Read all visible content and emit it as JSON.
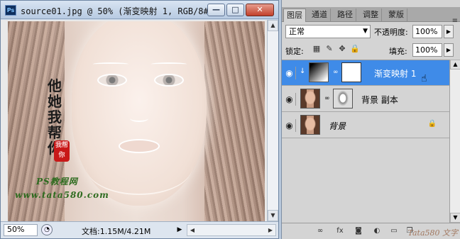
{
  "document": {
    "ps_badge": "Ps",
    "title": "source01.jpg @ 50% (渐变映射 1, RGB/8#) *",
    "window_buttons": [
      "—",
      "□",
      "✕"
    ],
    "image_text": {
      "calligraphy": [
        "他",
        "她",
        "我",
        "帮",
        "你"
      ],
      "seal": "我帮你",
      "watermark_line1": "PS教程网",
      "watermark_line2": "www.tata580.com"
    },
    "statusbar": {
      "zoom": "50%",
      "doc_info": "文档:1.15M/4.21M"
    }
  },
  "layers_panel": {
    "tabs": [
      "图层",
      "通道",
      "路径",
      "调整",
      "蒙版"
    ],
    "active_tab": "图层",
    "blend_mode": "正常",
    "opacity_label": "不透明度:",
    "opacity_value": "100%",
    "lock_label": "锁定:",
    "fill_label": "填充:",
    "fill_value": "100%",
    "layers": [
      {
        "name": "渐变映射 1",
        "selected": true,
        "thumbnail": "gradient-map",
        "mask": "white-mask"
      },
      {
        "name": "背景 副本",
        "selected": false,
        "thumbnail": "portrait",
        "mask": "edge-mask"
      },
      {
        "name": "背景",
        "selected": false,
        "thumbnail": "portrait",
        "locked": true
      }
    ],
    "footer_watermark": "Tata580 文字"
  },
  "colors": {
    "selection": "#3f8be8",
    "panel_bg": "#d4d4d4",
    "watermark_green": "#2e6b1f",
    "seal_red": "#c81818"
  }
}
